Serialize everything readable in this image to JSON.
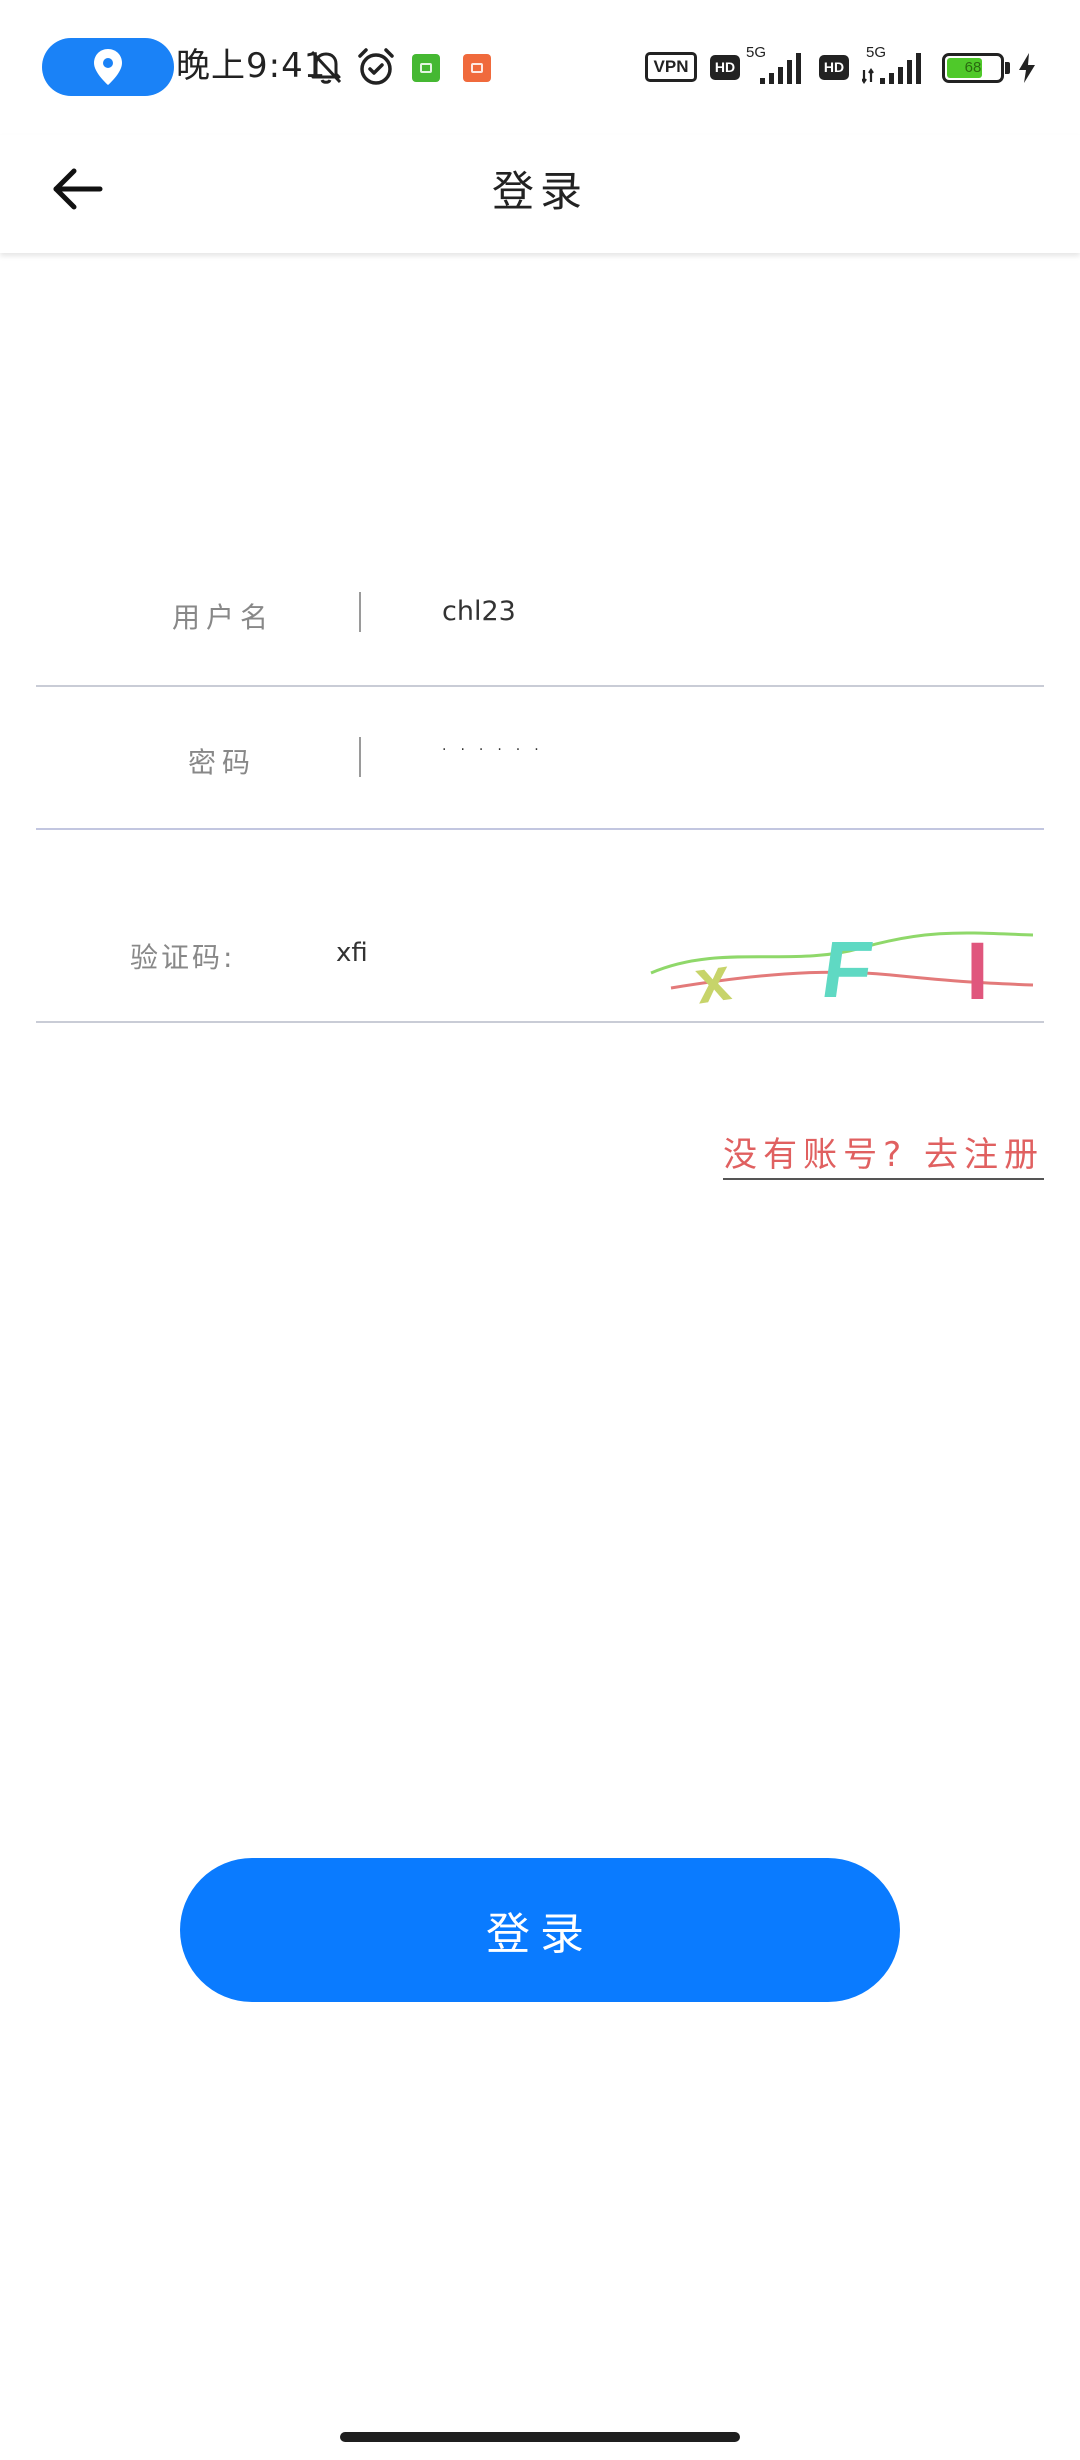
{
  "status_bar": {
    "time": "晚上9:41",
    "location_icon": "location-pin-icon",
    "mute_icon": "bell-off-icon",
    "alarm_icon": "alarm-clock-icon",
    "vpn_label": "VPN",
    "hd_label_1": "HD",
    "network_label_1": "5G",
    "hd_label_2": "HD",
    "network_label_2": "5G",
    "battery_level": "68",
    "battery_fraction": 0.68,
    "charging_icon": "bolt-icon"
  },
  "app_bar": {
    "back_icon": "arrow-left-icon",
    "title": "登录"
  },
  "form": {
    "username_label": "用户名",
    "username_value": "chl23",
    "password_label": "密码",
    "password_value": "······",
    "captcha_label": "验证码:",
    "captcha_value": "xfi",
    "captcha_chars": [
      "x",
      "F",
      "I"
    ],
    "register_link": "没有账号? 去注册"
  },
  "login_button": "登录",
  "colors": {
    "accent": "#0a7bff",
    "location_pill": "#1a82f7",
    "register_link": "#e06060",
    "divider": "#c9ccd6"
  }
}
